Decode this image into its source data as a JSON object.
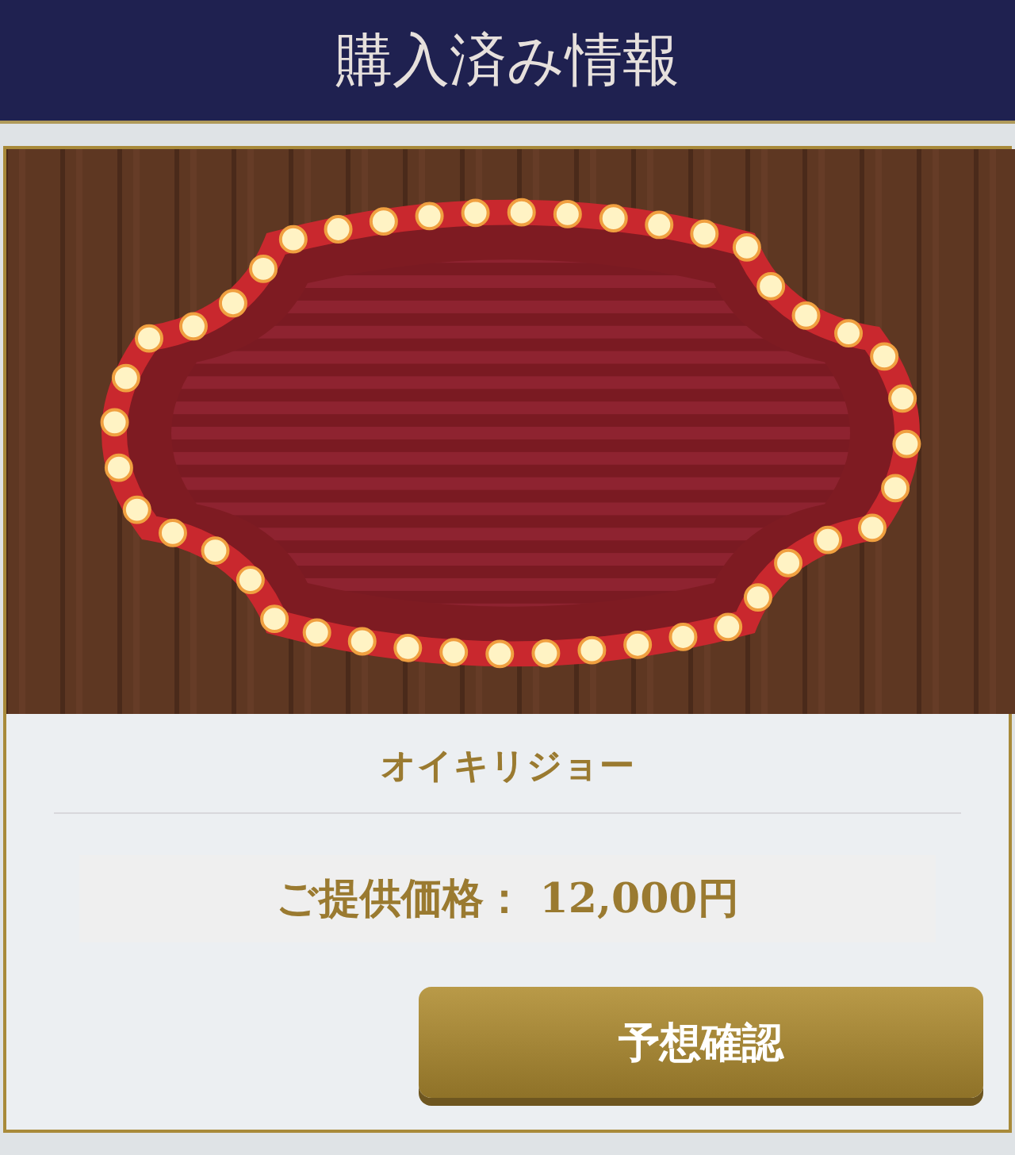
{
  "header": {
    "title": "購入済み情報"
  },
  "item": {
    "name": "オイキリジョー",
    "price": "ご提供価格： 12,000円",
    "button": "予想確認"
  }
}
